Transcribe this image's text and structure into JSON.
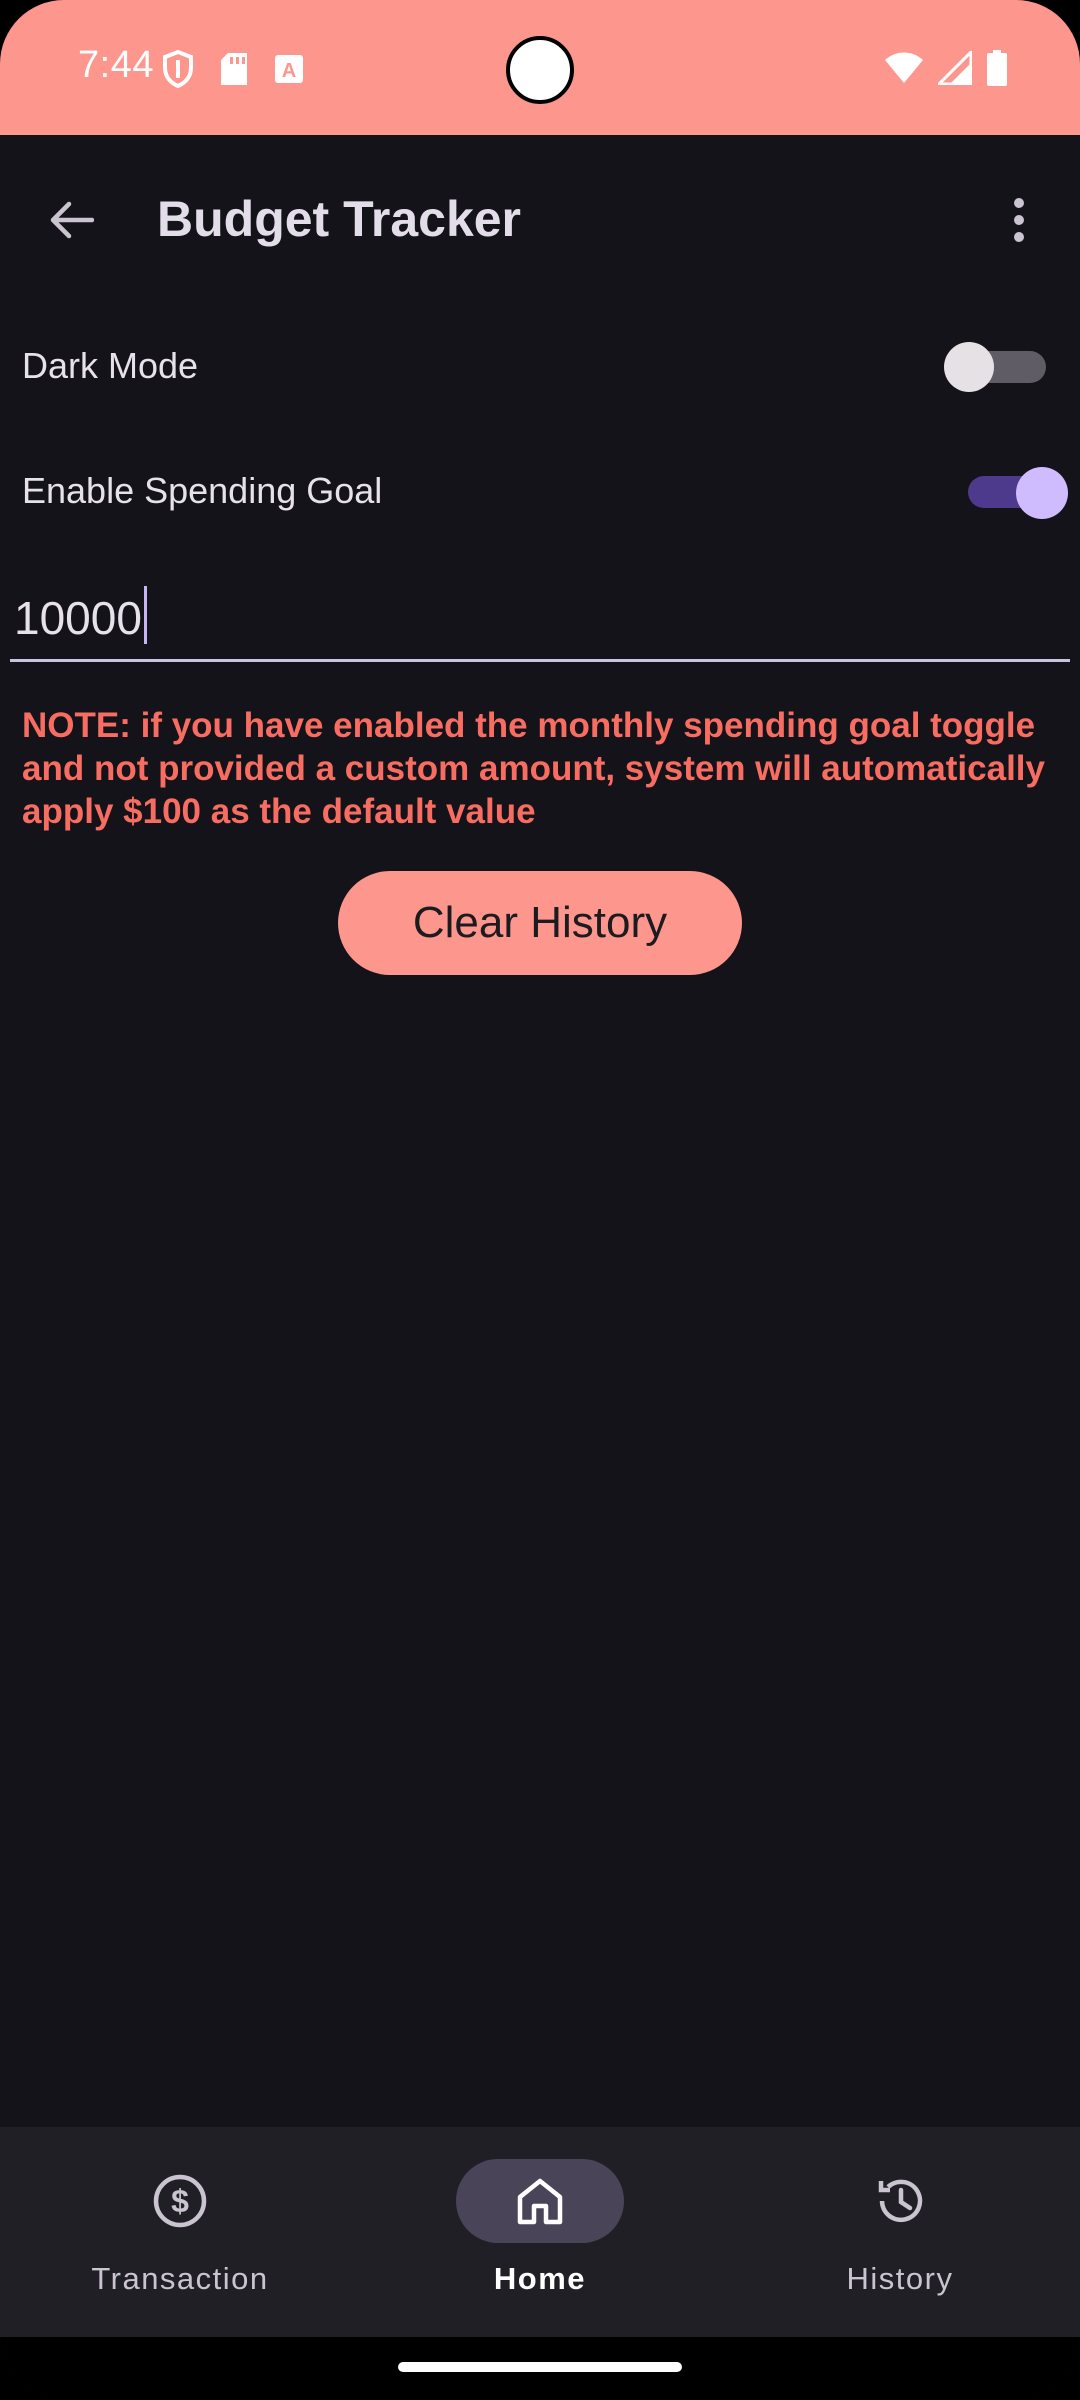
{
  "status_bar": {
    "time": "7:44",
    "left_icons": [
      "shield-icon",
      "sd-card-icon",
      "text-a-icon"
    ],
    "right_icons": [
      "wifi-icon",
      "cell-signal-icon",
      "battery-icon"
    ],
    "background": "#fd978d"
  },
  "app_bar": {
    "title": "Budget Tracker",
    "back_icon": "arrow-back-icon",
    "menu_icon": "more-vert-icon"
  },
  "settings": {
    "dark_mode": {
      "label": "Dark Mode",
      "enabled": false
    },
    "spending_goal": {
      "label": "Enable Spending Goal",
      "enabled": true
    },
    "goal_amount": "10000"
  },
  "note": "NOTE: if you have enabled the monthly spending goal toggle and not provided a custom amount, system will automatically apply $100 as the default value",
  "clear_button": "Clear History",
  "bottom_nav": {
    "items": [
      {
        "label": "Transaction",
        "icon": "dollar-circle-icon",
        "active": false
      },
      {
        "label": "Home",
        "icon": "home-icon",
        "active": true
      },
      {
        "label": "History",
        "icon": "history-icon",
        "active": false
      }
    ]
  },
  "colors": {
    "accent": "#fd978d",
    "note_text": "#f86d62",
    "background": "#15131a",
    "switch_on_thumb": "#cfbcff",
    "switch_on_track": "#4e3a8c"
  }
}
